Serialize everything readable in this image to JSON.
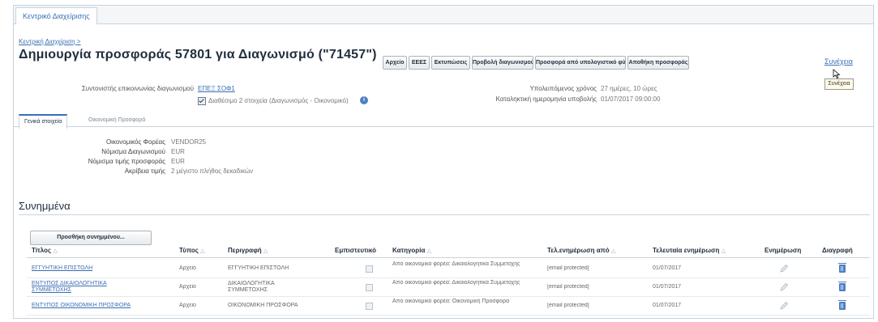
{
  "top_tab": "Κεντρικό Διαχείρισης",
  "breadcrumb": "Κεντρική Διαχείριση >",
  "page_title": "Δημιουργία προσφοράς 57801 για Διαγωνισμό (\"71457\")",
  "buttons": [
    "Αρχείο",
    "ΕΕΕΣ",
    "Εκτυπώσεις",
    "Προβολή διαγωνισμού",
    "Προσφορά από υπολογιστικό φύλλο",
    "Αποθήκη προσφοράς"
  ],
  "close_label": "Συνέχεια",
  "tooltip": "Συνέχεια",
  "header_info": {
    "contact_label": "Συντονιστής επικοινωνίας διαγωνισμού",
    "contact_value": "ΕΠΕΞ ΣΟΦ1",
    "checkbox_label": "Διαθέσιμο 2 στοιχεία (Διαγωνισμός - Οικονομικό)",
    "remaining_label": "Υπολειπόμενος χρόνος",
    "remaining_value": "27 ημέρες, 10 ώρες",
    "close_time_label": "Καταληκτική ημερομηνία υποβολής",
    "close_time_value": "01/07/2017 09:00:00"
  },
  "subtabs": [
    "Γενικά στοιχεία",
    "Οικονομική Προσφορά"
  ],
  "details": [
    {
      "label": "Οικονομικός Φορέας",
      "value": "VENDOR25"
    },
    {
      "label": "Νόμισμα Διαγωνισμού",
      "value": "EUR"
    },
    {
      "label": "Νόμισμα τιμής προσφοράς",
      "value": "EUR"
    },
    {
      "label": "Ακρίβεια τιμής",
      "value": "2 μέγιστο πλήθος δεκαδικών"
    }
  ],
  "section_title": "Συνημμένα",
  "add_button": "Προσθήκη συνημμένου...",
  "table": {
    "headers": [
      "Τίτλος",
      "Τύπος",
      "Περιγραφή",
      "Εμπιστευτικό",
      "Κατηγορία",
      "Τελ.ενημέρωση από",
      "Τελευταία ενημέρωση",
      "Ενημέρωση",
      "Διαγραφή"
    ],
    "rows": [
      {
        "title": "ΕΓΓΥΗΤΙΚΗ ΕΠΙΣΤΟΛΗ",
        "type": "Αρχείο",
        "description": "ΕΓΓΥΗΤΙΚΗ ΕΠΙΣΤΟΛΗ",
        "category": "Από οικονομικό φορέα: Δικαιολογητικά Συμμετοχής",
        "updated_by": "[email protected]",
        "updated_on": "01/07/2017"
      },
      {
        "title": "ΕΝΤΥΠΟΣ ΔΙΚΑΙΟΛΟΓΗΤΙΚΑ ΣΥΜΜΕΤΟΧΗΣ",
        "type": "Αρχείο",
        "description": "ΔΙΚΑΙΟΛΟΓΗΤΙΚΑ ΣΥΜΜΕΤΟΧΗΣ",
        "category": "Από οικονομικό φορέα: Δικαιολογητικά Συμμετοχής",
        "updated_by": "[email protected]",
        "updated_on": "01/07/2017"
      },
      {
        "title": "ΕΝΤΥΠΟΣ ΟΙΚΟΝΟΜΙΚΗ ΠΡΟΣΦΟΡΑ",
        "type": "Αρχείο",
        "description": "ΟΙΚΟΝΟΜΙΚΗ ΠΡΟΣΦΟΡΑ",
        "category": "Από οικονομικό φορέα: Οικονομική Προσφορά",
        "updated_by": "[email protected]",
        "updated_on": "01/07/2017"
      }
    ]
  },
  "colors": {
    "link": "#3a6eb4",
    "border": "#c9d3dc",
    "icon": "#4d7fc4"
  },
  "icons": [
    "checkbox-icon",
    "info-icon",
    "pencil-icon",
    "trash-icon",
    "cursor-icon"
  ]
}
